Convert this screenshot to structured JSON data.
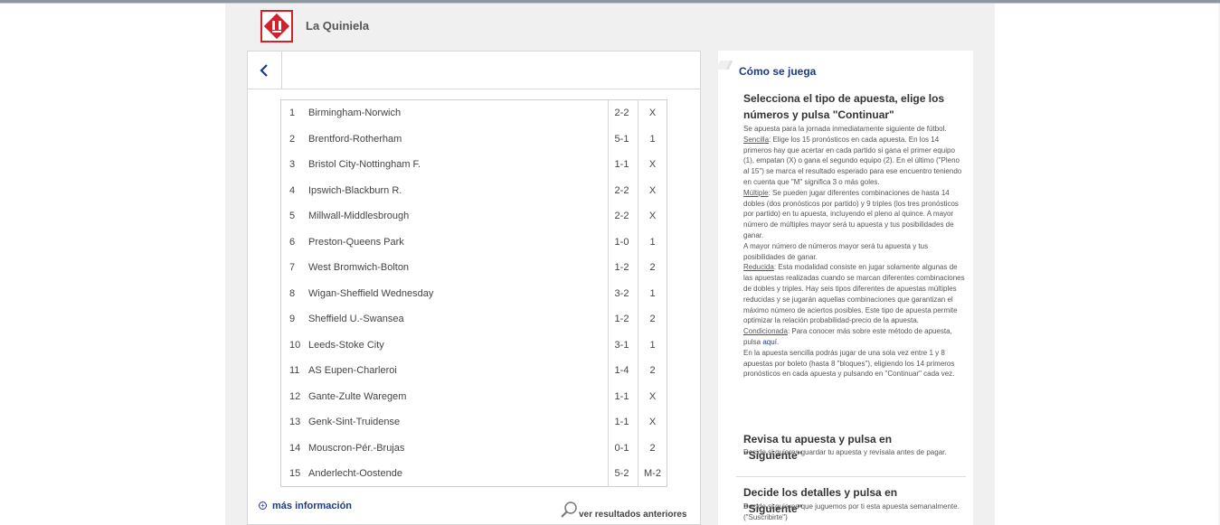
{
  "brand": {
    "name": "La Quiniela"
  },
  "header": {
    "back_icon": "chevron-left-icon"
  },
  "results": [
    {
      "num": "1",
      "match": "Birmingham-Norwich",
      "score": "2-2",
      "sign": "X"
    },
    {
      "num": "2",
      "match": "Brentford-Rotherham",
      "score": "5-1",
      "sign": "1"
    },
    {
      "num": "3",
      "match": "Bristol City-Nottingham F.",
      "score": "1-1",
      "sign": "X"
    },
    {
      "num": "4",
      "match": "Ipswich-Blackburn R.",
      "score": "2-2",
      "sign": "X"
    },
    {
      "num": "5",
      "match": "Millwall-Middlesbrough",
      "score": "2-2",
      "sign": "X"
    },
    {
      "num": "6",
      "match": "Preston-Queens Park",
      "score": "1-0",
      "sign": "1"
    },
    {
      "num": "7",
      "match": "West Bromwich-Bolton",
      "score": "1-2",
      "sign": "2"
    },
    {
      "num": "8",
      "match": "Wigan-Sheffield Wednesday",
      "score": "3-2",
      "sign": "1"
    },
    {
      "num": "9",
      "match": "Sheffield U.-Swansea",
      "score": "1-2",
      "sign": "2"
    },
    {
      "num": "10",
      "match": "Leeds-Stoke City",
      "score": "3-1",
      "sign": "1"
    },
    {
      "num": "11",
      "match": "AS Eupen-Charleroi",
      "score": "1-4",
      "sign": "2"
    },
    {
      "num": "12",
      "match": "Gante-Zulte Waregem",
      "score": "1-1",
      "sign": "X"
    },
    {
      "num": "13",
      "match": "Genk-Sint-Truidense",
      "score": "1-1",
      "sign": "X"
    },
    {
      "num": "14",
      "match": "Mouscron-Pér.-Brujas",
      "score": "0-1",
      "sign": "2"
    },
    {
      "num": "15",
      "match": "Anderlecht-Oostende",
      "score": "5-2",
      "sign": "M-2"
    }
  ],
  "footer": {
    "more_info": "más información",
    "prev_results": "ver resultados anteriores"
  },
  "how_to": {
    "title": "Cómo se juega",
    "step1_title": "Selecciona el tipo de apuesta, elige los números y pulsa \"Continuar\"",
    "step1_p1": "Se apuesta para la jornada inmediatamente siguiente de fútbol.",
    "step1_sencilla_label": "Sencilla",
    "step1_sencilla_text": ": Elige los 15 pronósticos en cada apuesta. En los 14 primeros hay que acertar en cada partido si gana el primer equipo (1), empatan (X) o gana el segundo equipo (2). En el último (\"Pleno al 15\") se marca el resultado esperado para ese encuentro teniendo en cuenta que \"M\" significa 3 o más goles.",
    "step1_multiple_label": "Múltiple",
    "step1_multiple_text": ": Se pueden jugar diferentes combinaciones de hasta 14 dobles (dos pronósticos por partido) y 9 triples (los tres pronósticos por partido) en tu apuesta, incluyendo el pleno al quince. A mayor número de múltiples mayor será tu apuesta y tus posibilidades de ganar.",
    "step1_p_mayor": "A mayor número de números mayor será tu apuesta y tus posibilidades de ganar.",
    "step1_reducida_label": "Reducida",
    "step1_reducida_text": ": Esta modalidad consiste en jugar solamente algunas de las apuestas realizadas cuando se marcan diferentes combinaciones de dobles y triples. Hay seis tipos diferentes de apuestas múltiples reducidas y se jugarán aquellas combinaciones que garantizan el máximo número de aciertos posibles. Este tipo de apuesta permite optimizar la relación probabilidad-precio de la apuesta.",
    "step1_condicionada_label": "Condicionada",
    "step1_condicionada_text": ": Para conocer más sobre este método de apuesta, pulsa ",
    "step1_aqui": "aquí",
    "step1_p_final": "En la apuesta sencilla podrás jugar de una sola vez entre 1 y 8 apuestas por boleto (hasta 8 \"bloques\"), eligiendo los 14 primeros pronósticos en cada apuesta y pulsando en \"Continuar\" cada vez.",
    "step2_title": "Revisa tu apuesta y pulsa en \"Siguiente\"",
    "step2_text": "Decide si quieres guardar tu apuesta y revísala antes de pagar.",
    "step3_title": "Decide los detalles y pulsa en \"Siguiente\"",
    "step3_text": "Decide si quieres que juguemos por ti esta apuesta semanalmente. (\"Suscribirte\")"
  }
}
